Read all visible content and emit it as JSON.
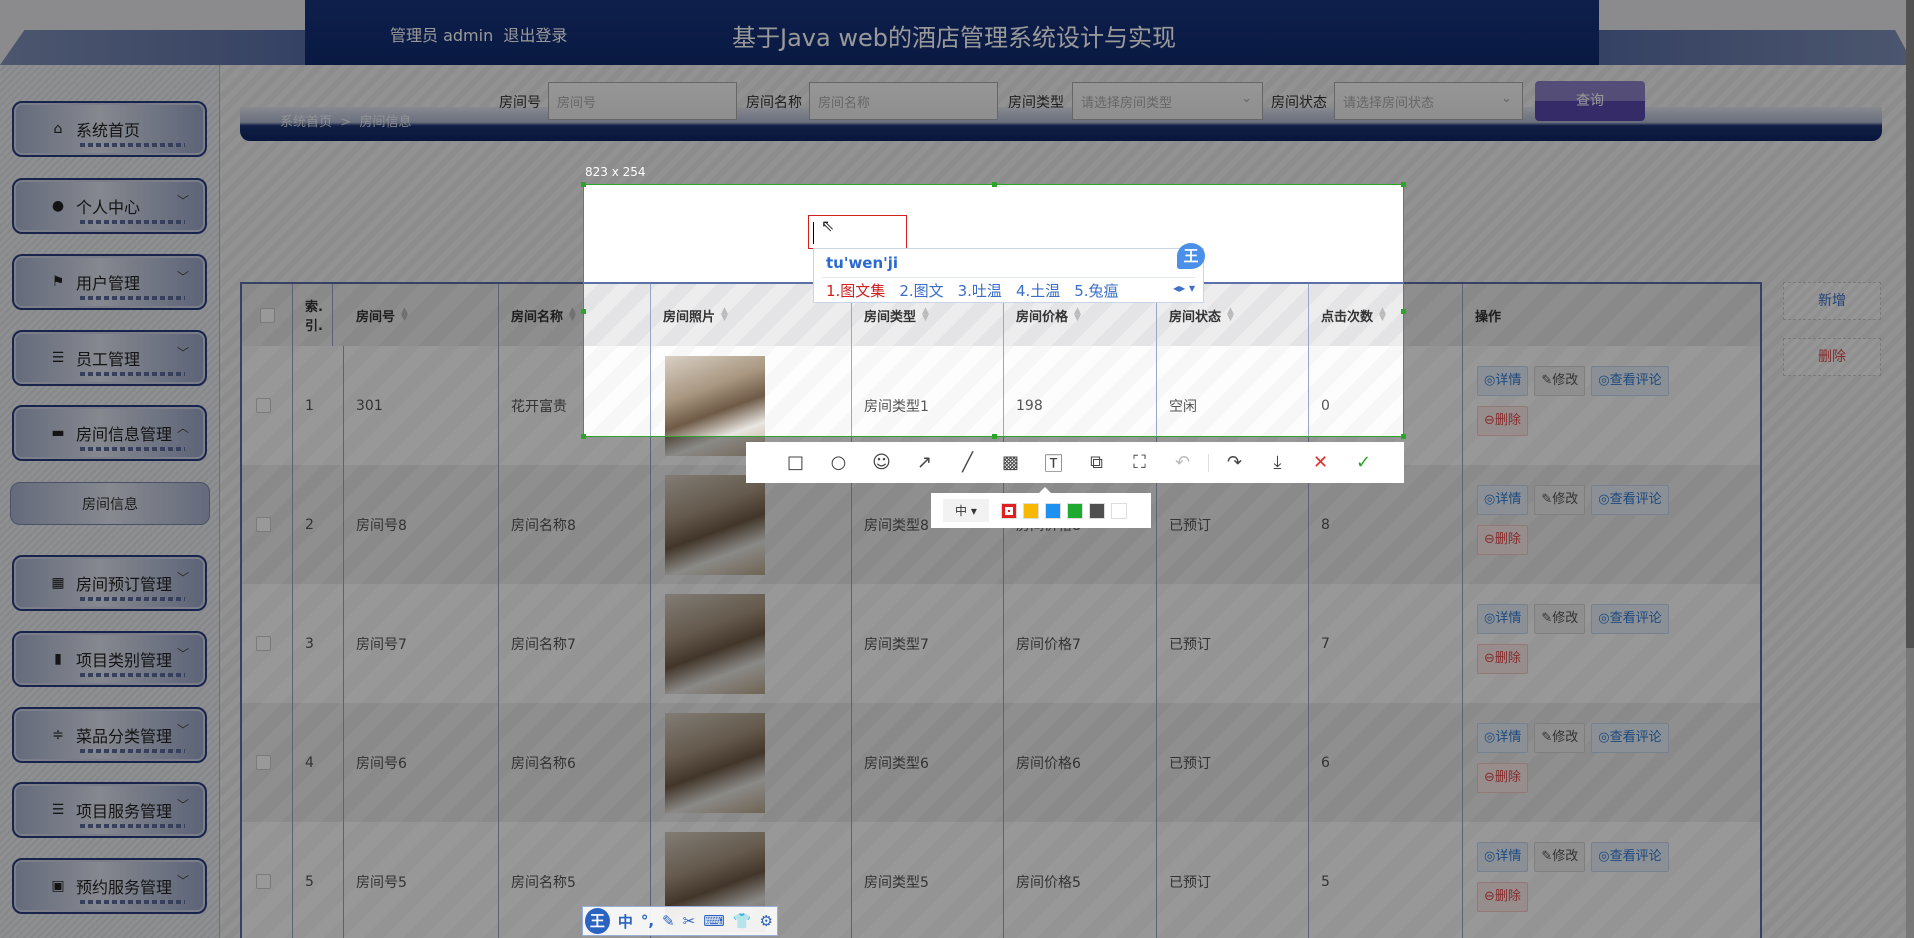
{
  "header": {
    "user": "管理员 admin",
    "logout": "退出登录",
    "title": "基于Java web的酒店管理系统设计与实现"
  },
  "sidebar": {
    "items": [
      {
        "label": "系统首页",
        "icon": "home-icon",
        "glyph": "⌂",
        "chev": false
      },
      {
        "label": "个人中心",
        "icon": "user-icon",
        "glyph": "●",
        "chev": true
      },
      {
        "label": "用户管理",
        "icon": "flag-icon",
        "glyph": "⚑",
        "chev": true
      },
      {
        "label": "员工管理",
        "icon": "list-icon",
        "glyph": "☰",
        "chev": true
      },
      {
        "label": "房间信息管理",
        "icon": "message-icon",
        "glyph": "▬",
        "chev": true,
        "open": true
      },
      {
        "label": "房间预订管理",
        "icon": "grid-icon",
        "glyph": "▦",
        "chev": true
      },
      {
        "label": "项目类别管理",
        "icon": "bar-chart-icon",
        "glyph": "▮",
        "chev": true
      },
      {
        "label": "菜品分类管理",
        "icon": "sliders-icon",
        "glyph": "≑",
        "chev": true
      },
      {
        "label": "项目服务管理",
        "icon": "indent-list-icon",
        "glyph": "☰",
        "chev": true
      },
      {
        "label": "预约服务管理",
        "icon": "clipboard-icon",
        "glyph": "▣",
        "chev": true
      }
    ],
    "sub_item": "房间信息"
  },
  "breadcrumb": {
    "home": "系统首页",
    "sep": ">",
    "current": "房间信息"
  },
  "search": {
    "room_no_label": "房间号",
    "room_no_placeholder": "房间号",
    "room_name_label": "房间名称",
    "room_name_placeholder": "房间名称",
    "room_type_label": "房间类型",
    "room_type_placeholder": "请选择房间类型",
    "room_status_label": "房间状态",
    "room_status_placeholder": "请选择房间状态",
    "query": "查询"
  },
  "actions": {
    "add": "新增",
    "delete": "删除"
  },
  "table": {
    "headers": [
      "",
      "索.引.",
      "房间号",
      "房间名称",
      "房间照片",
      "房间类型",
      "房间价格",
      "房间状态",
      "点击次数",
      "操作"
    ],
    "rows": [
      [
        "1",
        "301",
        "花开富贵",
        "房间类型1",
        "198",
        "空闲",
        "0"
      ],
      [
        "2",
        "房间号8",
        "房间名称8",
        "房间类型8",
        "房间价格8",
        "已预订",
        "8"
      ],
      [
        "3",
        "房间号7",
        "房间名称7",
        "房间类型7",
        "房间价格7",
        "已预订",
        "7"
      ],
      [
        "4",
        "房间号6",
        "房间名称6",
        "房间类型6",
        "房间价格6",
        "已预订",
        "6"
      ],
      [
        "5",
        "房间号5",
        "房间名称5",
        "房间类型5",
        "房间价格5",
        "已预订",
        "5"
      ]
    ],
    "ops": {
      "detail": "◎详情",
      "edit": "✎修改",
      "comments": "◎查看评论",
      "delete": "⊖删除"
    }
  },
  "screenshot_tool": {
    "size": "823 x 254",
    "ime_pinyin": "tu'wen'ji",
    "candidates": [
      "1.图文集",
      "2.图文",
      "3.吐温",
      "4.土温",
      "5.兔瘟"
    ],
    "ime_logo": "王",
    "font_size": "中 ▾",
    "tools": [
      {
        "n": "rectangle-icon",
        "g": "□"
      },
      {
        "n": "circle-icon",
        "g": "○"
      },
      {
        "n": "emoji-icon",
        "g": "☺"
      },
      {
        "n": "arrow-icon",
        "g": "↗"
      },
      {
        "n": "pen-icon",
        "g": "╱"
      },
      {
        "n": "mosaic-icon",
        "g": "▩"
      },
      {
        "n": "text-icon",
        "g": "🅃"
      },
      {
        "n": "copy-icon",
        "g": "⧉"
      },
      {
        "n": "ocr-icon",
        "g": "⛶"
      },
      {
        "n": "undo-icon",
        "g": "↶",
        "dis": true
      },
      {
        "sep": true
      },
      {
        "n": "share-icon",
        "g": "↷"
      },
      {
        "n": "save-icon",
        "g": "⤓"
      },
      {
        "n": "cancel-icon",
        "g": "✕",
        "cls": "red"
      },
      {
        "n": "confirm-icon",
        "g": "✓",
        "cls": "grn"
      }
    ],
    "colors": [
      "#e02020",
      "#f6b800",
      "#1e90f0",
      "#1eaa2e",
      "#505050",
      "#ffffff"
    ]
  },
  "ime_bar": {
    "logo": "王",
    "items": [
      "中",
      "°,",
      "✎",
      "✂",
      "⌨",
      "👕",
      "⚙"
    ]
  }
}
